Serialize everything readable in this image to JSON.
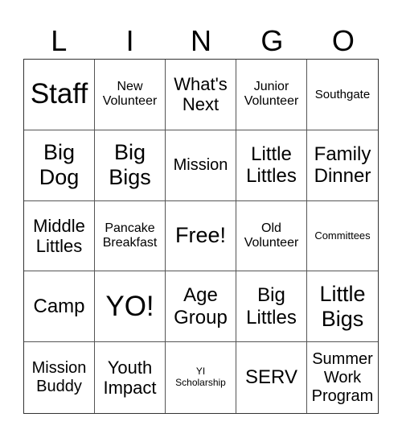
{
  "header": [
    "L",
    "I",
    "N",
    "G",
    "O"
  ],
  "cells": [
    {
      "text": "Staff",
      "size": "s36"
    },
    {
      "text": "New\nVolunteer",
      "size": "s16"
    },
    {
      "text": "What's\nNext",
      "size": "s22"
    },
    {
      "text": "Junior\nVolunteer",
      "size": "s16"
    },
    {
      "text": "Southgate",
      "size": "s15"
    },
    {
      "text": "Big\nDog",
      "size": "s28"
    },
    {
      "text": "Big\nBigs",
      "size": "s28"
    },
    {
      "text": "Mission",
      "size": "s19"
    },
    {
      "text": "Little\nLittles",
      "size": "s24"
    },
    {
      "text": "Family\nDinner",
      "size": "s24"
    },
    {
      "text": "Middle\nLittles",
      "size": "s22"
    },
    {
      "text": "Pancake\nBreakfast",
      "size": "s16"
    },
    {
      "text": "Free!",
      "size": "s28"
    },
    {
      "text": "Old\nVolunteer",
      "size": "s16"
    },
    {
      "text": "Committees",
      "size": "s13"
    },
    {
      "text": "Camp",
      "size": "s24"
    },
    {
      "text": "YO!",
      "size": "s36"
    },
    {
      "text": "Age\nGroup",
      "size": "s24"
    },
    {
      "text": "Big\nLittles",
      "size": "s24"
    },
    {
      "text": "Little\nBigs",
      "size": "s28"
    },
    {
      "text": "Mission\nBuddy",
      "size": "s19"
    },
    {
      "text": "Youth\nImpact",
      "size": "s22"
    },
    {
      "text": "YI\nScholarship",
      "size": "s12"
    },
    {
      "text": "SERV",
      "size": "s24"
    },
    {
      "text": "Summer\nWork\nProgram",
      "size": "s19"
    }
  ]
}
